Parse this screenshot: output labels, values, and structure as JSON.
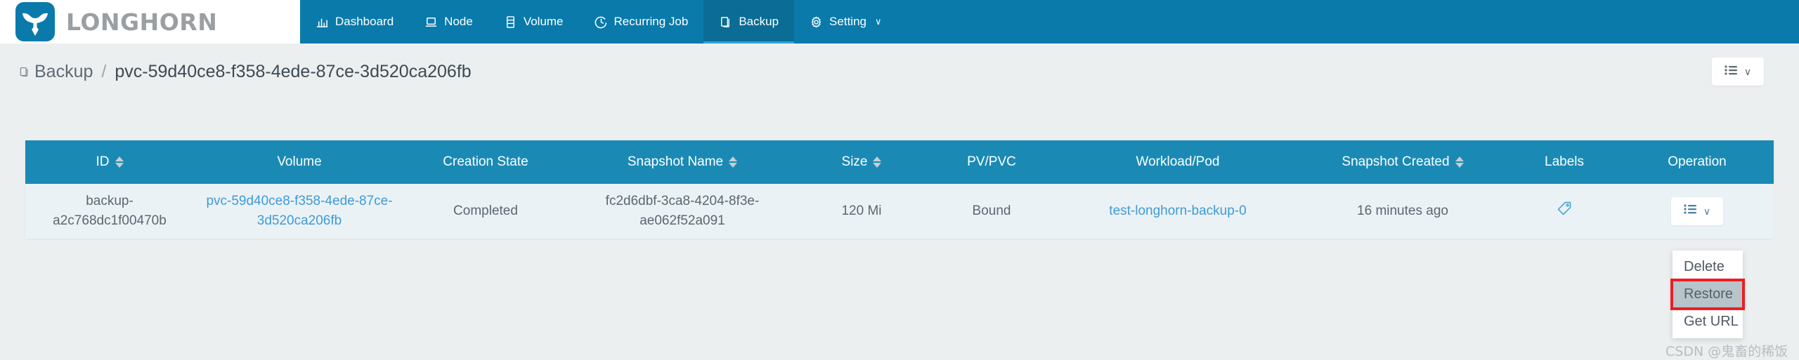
{
  "brand": {
    "name": "LONGHORN",
    "logo_icon": "longhorn-bull-icon",
    "logo_color": "#0a7aab"
  },
  "nav": {
    "items": [
      {
        "label": "Dashboard",
        "icon": "bar-chart-icon",
        "active": false
      },
      {
        "label": "Node",
        "icon": "laptop-icon",
        "active": false
      },
      {
        "label": "Volume",
        "icon": "database-icon",
        "active": false
      },
      {
        "label": "Recurring Job",
        "icon": "clock-icon",
        "active": false
      },
      {
        "label": "Backup",
        "icon": "copy-icon",
        "active": true
      },
      {
        "label": "Setting",
        "icon": "gear-icon",
        "active": false,
        "chevron": "∨"
      }
    ],
    "bar_color": "#0a7aab",
    "active_color": "#0b6c95"
  },
  "breadcrumb": {
    "icon": "backup-icon",
    "root": "Backup",
    "separator": "/",
    "current": "pvc-59d40ce8-f358-4ede-87ce-3d520ca206fb"
  },
  "toolbar": {
    "list_icon": "list-icon",
    "chevron": "∨"
  },
  "table": {
    "header_color": "#1a8ab5",
    "row_color": "#ebf2f5",
    "columns": [
      {
        "label": "ID",
        "sortable": true
      },
      {
        "label": "Volume",
        "sortable": false
      },
      {
        "label": "Creation State",
        "sortable": false
      },
      {
        "label": "Snapshot Name",
        "sortable": true
      },
      {
        "label": "Size",
        "sortable": true
      },
      {
        "label": "PV/PVC",
        "sortable": false
      },
      {
        "label": "Workload/Pod",
        "sortable": false
      },
      {
        "label": "Snapshot Created",
        "sortable": true
      },
      {
        "label": "Labels",
        "sortable": false
      },
      {
        "label": "Operation",
        "sortable": false
      }
    ],
    "rows": [
      {
        "id": "backup-a2c768dc1f00470b",
        "volume": "pvc-59d40ce8-f358-4ede-87ce-3d520ca206fb",
        "creation_state": "Completed",
        "snapshot_name": "fc2d6dbf-3ca8-4204-8f3e-ae062f52a091",
        "size": "120 Mi",
        "pv_pvc": "Bound",
        "workload_pod": "test-longhorn-backup-0",
        "snapshot_created": "16 minutes ago",
        "labels_icon": "tag-icon",
        "operation_icon": "list-icon",
        "operation_chevron": "∨"
      }
    ]
  },
  "dropdown": {
    "items": [
      {
        "label": "Delete",
        "highlighted": false
      },
      {
        "label": "Restore",
        "highlighted": true
      },
      {
        "label": "Get URL",
        "highlighted": false
      }
    ],
    "highlight_border_color": "#ee1c23",
    "highlight_bg_color": "#b7c4c9"
  },
  "watermark": {
    "text": "CSDN @鬼畜的稀饭"
  }
}
